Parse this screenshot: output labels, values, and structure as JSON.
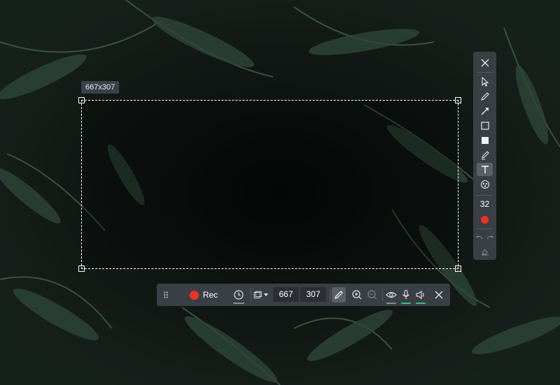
{
  "selection": {
    "size_label": "667x307"
  },
  "tool_panel": {
    "tools": [
      {
        "name": "close-icon"
      },
      {
        "name": "cursor-icon"
      },
      {
        "name": "pen-icon"
      },
      {
        "name": "arrow-icon"
      },
      {
        "name": "rectangle-outline-icon"
      },
      {
        "name": "rectangle-filled-icon"
      },
      {
        "name": "marker-icon"
      },
      {
        "name": "text-icon",
        "active": true
      },
      {
        "name": "blur-icon"
      }
    ],
    "line_width": "32",
    "color": "#ef3124",
    "undo_icon": "undo-icon",
    "redo_icon": "redo-icon",
    "clear_icon": "eraser-icon"
  },
  "record_bar": {
    "rec_label": "Rec",
    "rec_color": "#ef3124",
    "width_value": "667",
    "height_value": "307",
    "icons": [
      "drag-handle-icon",
      "timer-icon",
      "capture-area-icon",
      "pen-icon",
      "zoom-in-icon",
      "zoom-out-icon",
      "eye-icon",
      "microphone-icon",
      "speaker-icon",
      "close-icon"
    ],
    "accent_green": "#2ec27e"
  }
}
